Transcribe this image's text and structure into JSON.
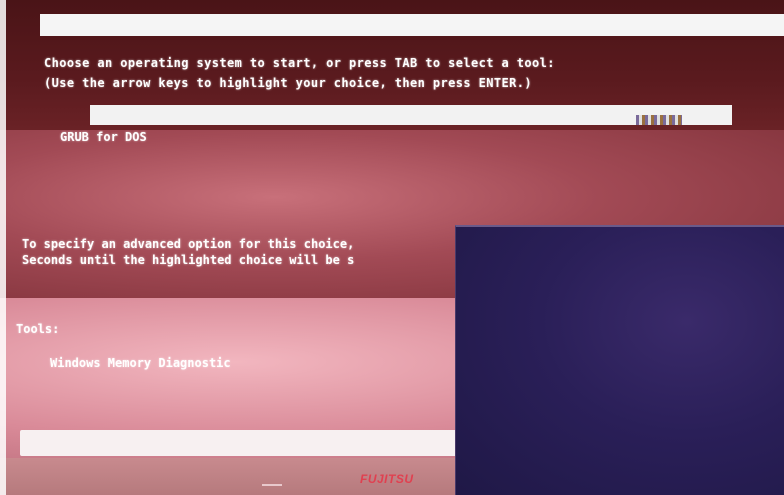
{
  "boot_menu": {
    "instruction_line_1": "Choose an operating system to start, or press TAB to select a tool:",
    "instruction_line_2": "(Use the arrow keys to highlight your choice, then press ENTER.)",
    "os_entries": [
      {
        "label": "GRUB for DOS",
        "selected": true
      }
    ],
    "advanced_line_1": "To specify an advanced option for this choice,",
    "advanced_line_2": "Seconds until the highlighted choice will be s"
  },
  "tools": {
    "heading": "Tools:",
    "items": [
      {
        "label": "Windows Memory Diagnostic"
      }
    ]
  },
  "bezel": {
    "brand": "FUJITSU"
  },
  "colors": {
    "screen_top": "#4a1417",
    "screen_mid": "#a24a55",
    "screen_low": "#d98a98",
    "highlight_bar": "#f2f2f2",
    "overlay_blue": "#2a1f58",
    "brand_red": "#e04050"
  }
}
